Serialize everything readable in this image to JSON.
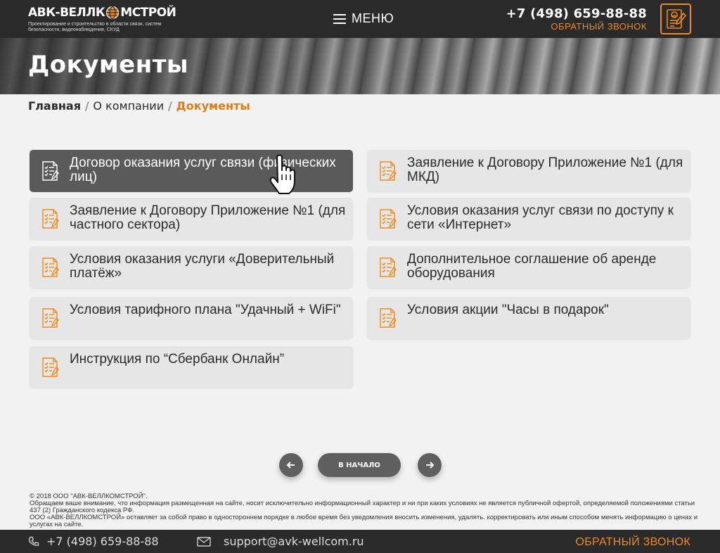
{
  "colors": {
    "accent": "#f08a1c",
    "header_bg": "#2a2a2a",
    "card_bg": "#e6e6e6",
    "card_active_bg": "#5a5a5a"
  },
  "header": {
    "logo_left": "АВК-ВЕЛЛК",
    "logo_right": "МСТРОЙ",
    "logo_subtitle": "Проектирование и строительство в области связи, систем безопасности, видеонаблюдения, СКУД",
    "menu_label": "МЕНЮ",
    "phone": "+7 (498) 659-88-88",
    "callback": "ОБРАТНЫЙ ЗВОНОК"
  },
  "banner": {
    "title": "Документы"
  },
  "breadcrumb": {
    "home": "Главная",
    "about": "О компании",
    "current": "Документы"
  },
  "documents": [
    {
      "label": "Договор оказания услуг связи (физических лиц)"
    },
    {
      "label": "Заявление к Договору Приложение №1 (для МКД)"
    },
    {
      "label": "Заявление к Договору Приложение №1 (для частного сектора)"
    },
    {
      "label": "Условия оказания услуг связи по доступу к сети «Интернет»"
    },
    {
      "label": "Условия оказания услуги «Доверительный платёж»"
    },
    {
      "label": "Дополнительное соглашение об аренде оборудования"
    },
    {
      "label": "Условия тарифного плана \"Удачный + WiFi\""
    },
    {
      "label": "Условия акции \"Часы в подарок\""
    },
    {
      "label": "Инструкция по “Сбербанк Онлайн”"
    }
  ],
  "pager": {
    "home_label": "В НАЧАЛО"
  },
  "copyright": {
    "line1": "© 2018 ООО \"АВК-ВЕЛЛКОМСТРОЙ\".",
    "line2": "Обращаем ваше внимание, что информация размещенная на сайте, носит исключительно информационный характер и ни при каких условиях не является публичной офертой, определяемой положениями статьи 437 (2) Гражданского кодекса РФ.",
    "line3": "ООО «АВК-ВЕЛЛКОМСТРОЙ» оставляет за собой право в одностороннем порядке в любое время без уведомления вносить изменения, удалять. корректировать или иным способом менять информацию о ценах и услугах на сайте."
  },
  "footer": {
    "phone": "+7 (498) 659-88-88",
    "email": "support@avk-wellcom.ru",
    "callback": "ОБРАТНЫЙ ЗВОНОК"
  }
}
